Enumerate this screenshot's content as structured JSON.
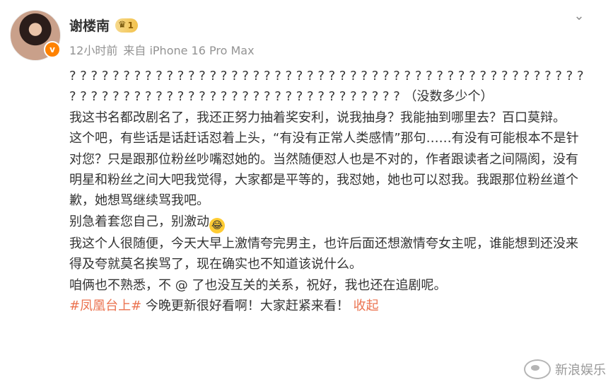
{
  "post": {
    "username": "谢楼南",
    "level": "1",
    "time": "12小时前",
    "source": "来自 iPhone 16 Pro Max",
    "paragraphs": [
      "? ? ? ? ? ? ? ? ? ? ? ? ? ? ? ? ? ? ? ? ? ? ? ? ? ? ? ? ? ? ? ? ? ? ? ? ? ? ? ? ? ? ? ? ? ? ? ? ? ? ? ? ? ? ? ? ? ? ? ? ? ? ? ? ? ? ? ? ? ? ? ? ? ? ? ? ? ? ? （没数多少个）",
      "我这书名都改剧名了，我还正努力抽着奖安利，说我抽身？我能抽到哪里去？百口莫辩。",
      "这个吧，有些话是话赶话怼着上头，“有没有正常人类感情”那句……有没有可能根本不是针对您？只是跟那位粉丝吵嘴怼她的。当然随便怼人也是不对的，作者跟读者之间隔阂，没有明星和粉丝之间大吧我觉得，大家都是平等的，我怼她，她也可以怼我。我跟那位粉丝道个歉，她想骂继续骂我吧。",
      "我这个人很随便，今天大早上激情夸完男主，也许后面还想激情夸女主呢，谁能想到还没来得及夸就莫名挨骂了，现在确实也不知道该说什么。",
      "咱俩也不熟悉，不 @ 了也没互关的关系，祝好，我也还在追剧呢。"
    ],
    "line_with_emoji": "别急着套您自己，别激动",
    "hashtag": "#凤凰台上#",
    "tagline": " 今晚更新很好看啊！大家赶紧来看！",
    "collapse_label": "收起"
  },
  "watermark": {
    "text": "新浪娱乐"
  },
  "colors": {
    "accent": "#eb7350",
    "text": "#333333",
    "meta": "#939393"
  }
}
